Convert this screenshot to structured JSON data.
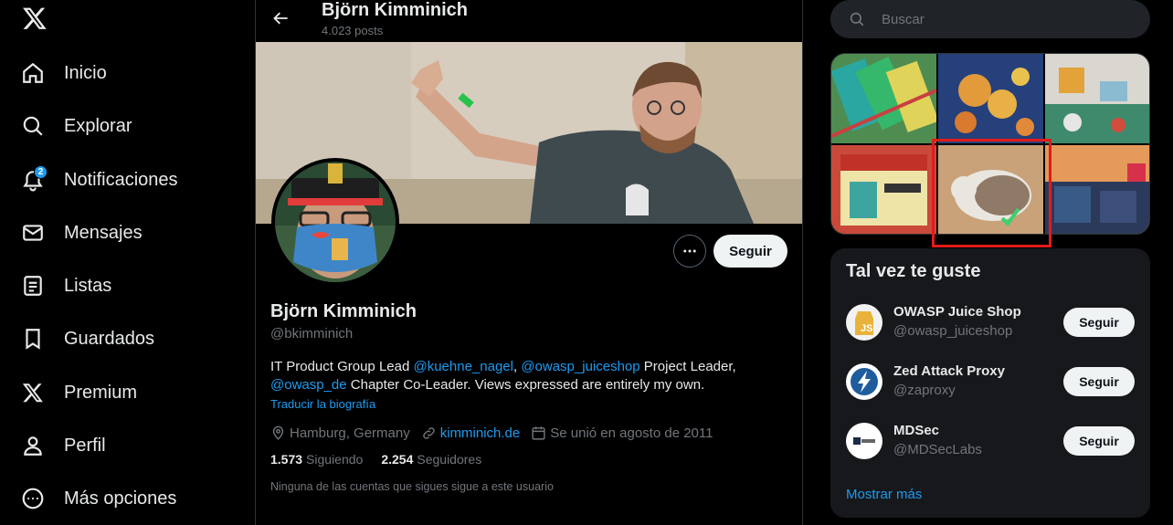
{
  "nav": {
    "items": [
      {
        "label": "Inicio",
        "icon": "home-icon"
      },
      {
        "label": "Explorar",
        "icon": "search-icon"
      },
      {
        "label": "Notificaciones",
        "icon": "bell-icon",
        "badge": "2"
      },
      {
        "label": "Mensajes",
        "icon": "envelope-icon"
      },
      {
        "label": "Listas",
        "icon": "list-icon"
      },
      {
        "label": "Guardados",
        "icon": "bookmark-icon"
      },
      {
        "label": "Premium",
        "icon": "x-logo-icon"
      },
      {
        "label": "Perfil",
        "icon": "person-icon"
      },
      {
        "label": "Más opciones",
        "icon": "more-circle-icon"
      }
    ]
  },
  "header": {
    "name": "Björn Kimminich",
    "posts": "4.023 posts"
  },
  "profile": {
    "name": "Björn Kimminich",
    "handle": "@bkimminich",
    "follow_label": "Seguir",
    "bio": {
      "t1": "IT Product Group Lead ",
      "m1": "@kuehne_nagel",
      "t2": ", ",
      "m2": "@owasp_juiceshop",
      "t3": " Project Leader, ",
      "m3": "@owasp_de",
      "t4": " Chapter Co-Leader. Views expressed are entirely my own."
    },
    "translate": "Traducir la biografía",
    "location": "Hamburg, Germany",
    "website": "kimminich.de",
    "joined": "Se unió en agosto de 2011",
    "following_count": "1.573",
    "following_label": "Siguiendo",
    "followers_count": "2.254",
    "followers_label": "Seguidores",
    "no_mutuals": "Ninguna de las cuentas que sigues sigue a este usuario"
  },
  "search": {
    "placeholder": "Buscar"
  },
  "suggestions": {
    "title": "Tal vez te guste",
    "follow_label": "Seguir",
    "show_more": "Mostrar más",
    "accounts": [
      {
        "name": "OWASP Juice Shop",
        "handle": "@owasp_juiceshop"
      },
      {
        "name": "Zed Attack Proxy",
        "handle": "@zaproxy"
      },
      {
        "name": "MDSec",
        "handle": "@MDSecLabs"
      }
    ]
  },
  "colors": {
    "accent": "#1d9bf0",
    "highlight": "#e21b1b"
  }
}
